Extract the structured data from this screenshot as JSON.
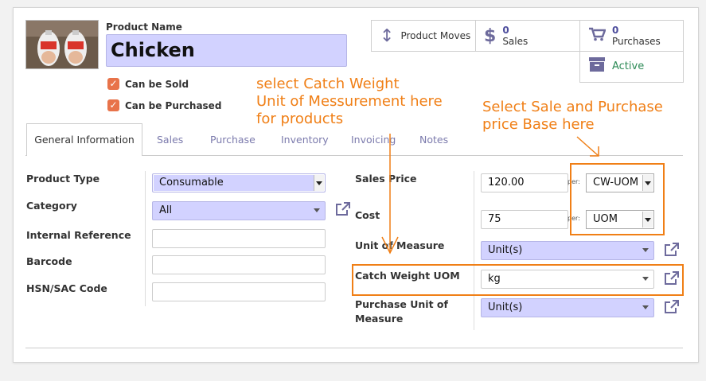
{
  "product": {
    "name_label": "Product Name",
    "name": "Chicken",
    "can_be_sold_label": "Can be Sold",
    "can_be_purchased_label": "Can be Purchased",
    "can_be_sold": true,
    "can_be_purchased": true
  },
  "stats": {
    "moves_label": "Product Moves",
    "sales_count": "0",
    "sales_label": "Sales",
    "purchases_count": "0",
    "purchases_label": "Purchases",
    "active_label": "Active"
  },
  "annotations": {
    "catch_weight_note": "select Catch Weight\nUnit of Messurement here\nfor products",
    "price_base_note": "Select Sale and Purchase\nprice Base here"
  },
  "tabs": [
    {
      "label": "General Information",
      "active": true
    },
    {
      "label": "Sales"
    },
    {
      "label": "Purchase"
    },
    {
      "label": "Inventory"
    },
    {
      "label": "Invoicing"
    },
    {
      "label": "Notes"
    }
  ],
  "left_fields": {
    "product_type_label": "Product Type",
    "product_type_value": "Consumable",
    "category_label": "Category",
    "category_value": "All",
    "internal_ref_label": "Internal Reference",
    "internal_ref_value": "",
    "barcode_label": "Barcode",
    "barcode_value": "",
    "hsn_label": "HSN/SAC Code",
    "hsn_value": ""
  },
  "right_fields": {
    "sales_price_label": "Sales Price",
    "sales_price_value": "120.00",
    "per_label": "per:",
    "sales_price_uom": "CW-UOM",
    "cost_label": "Cost",
    "cost_value": "75",
    "cost_uom": "UOM",
    "uom_label": "Unit of Measure",
    "uom_value": "Unit(s)",
    "cw_uom_label": "Catch Weight UOM",
    "cw_uom_value": "kg",
    "purchase_uom_label": "Purchase Unit of Measure",
    "purchase_uom_value": "Unit(s)"
  },
  "colors": {
    "accent": "#6d6a9c",
    "required_field": "#d2d2ff",
    "annotation": "#f07f16",
    "checkbox": "#e8734a"
  },
  "icons": [
    "arrows-vertical-icon",
    "dollar-icon",
    "cart-icon",
    "archive-icon",
    "external-link-icon",
    "checkbox-checked-icon"
  ]
}
